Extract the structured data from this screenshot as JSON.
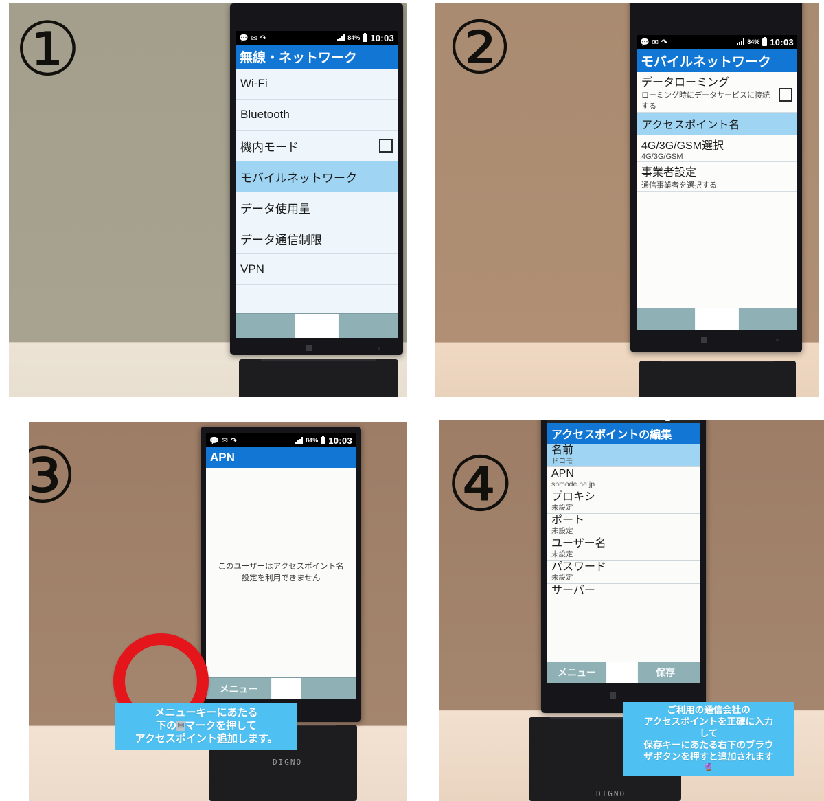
{
  "meta": {
    "device_brand": "DIGNO",
    "colors": {
      "title_blue": "#1277d4",
      "selected_row": "#9fd4f3",
      "navbar": "#8fb0b5",
      "caption_bg": "#4fc0f2",
      "highlight_ring": "#e4151b"
    }
  },
  "status_bar": {
    "icons": [
      "message-icon",
      "envelope-icon",
      "share-icon"
    ],
    "signal": "signal-bars-icon",
    "battery_percent": "84%",
    "battery": "battery-icon",
    "clock": "10:03"
  },
  "panels": [
    {
      "number": "①",
      "title": "無線・ネットワーク",
      "rows": [
        {
          "label": "Wi-Fi",
          "sub": "",
          "selected": false,
          "checkbox": false
        },
        {
          "label": "Bluetooth",
          "sub": "",
          "selected": false,
          "checkbox": false
        },
        {
          "label": "機内モード",
          "sub": "",
          "selected": false,
          "checkbox": true
        },
        {
          "label": "モバイルネットワーク",
          "sub": "",
          "selected": true,
          "checkbox": false
        },
        {
          "label": "データ使用量",
          "sub": "",
          "selected": false,
          "checkbox": false
        },
        {
          "label": "データ通信制限",
          "sub": "",
          "selected": false,
          "checkbox": false
        },
        {
          "label": "VPN",
          "sub": "",
          "selected": false,
          "checkbox": false
        }
      ],
      "navbar": {
        "menu": "",
        "home": "home-key",
        "right": ""
      }
    },
    {
      "number": "②",
      "title": "モバイルネットワーク",
      "rows": [
        {
          "label": "データローミング",
          "sub": "ローミング時にデータサービスに接続する",
          "selected": false,
          "checkbox": true
        },
        {
          "label": "アクセスポイント名",
          "sub": "",
          "selected": true,
          "checkbox": false
        },
        {
          "label": "4G/3G/GSM選択",
          "sub": "4G/3G/GSM",
          "selected": false,
          "checkbox": false
        },
        {
          "label": "事業者設定",
          "sub": "通信事業者を選択する",
          "selected": false,
          "checkbox": false
        }
      ],
      "navbar": {
        "menu": "",
        "home": "home-key",
        "right": ""
      }
    },
    {
      "number": "③",
      "title": "APN",
      "empty_message": "このユーザーはアクセスポイント名設定を利用できません",
      "navbar": {
        "menu": "メニュー",
        "home": "home-key",
        "right": ""
      },
      "caption": {
        "line1": "メニューキーにあたる",
        "line2_before": "下の",
        "line2_glyph": "✉",
        "line2_after": "マークを押して",
        "line3": "アクセスポイント追加します。"
      }
    },
    {
      "number": "④",
      "title": "アクセスポイントの編集",
      "rows": [
        {
          "label": "名前",
          "sub": "ドコモ",
          "selected": true,
          "checkbox": false
        },
        {
          "label": "APN",
          "sub": "spmode.ne.jp",
          "selected": false,
          "checkbox": false
        },
        {
          "label": "プロキシ",
          "sub": "未設定",
          "selected": false,
          "checkbox": false
        },
        {
          "label": "ポート",
          "sub": "未設定",
          "selected": false,
          "checkbox": false
        },
        {
          "label": "ユーザー名",
          "sub": "未設定",
          "selected": false,
          "checkbox": false
        },
        {
          "label": "パスワード",
          "sub": "未設定",
          "selected": false,
          "checkbox": false
        },
        {
          "label": "サーバー",
          "sub": "",
          "selected": false,
          "checkbox": false
        }
      ],
      "navbar": {
        "menu": "メニュー",
        "home": "home-key",
        "right": "保存"
      },
      "caption": {
        "line1": "ご利用の通信会社の",
        "line2": "アクセスポイントを正確に入力",
        "line3": "して",
        "line4": "保存キーにあたる右下のブラウ",
        "line5": "ザボタンを押すと追加されます",
        "emoji": "🔮"
      }
    }
  ]
}
